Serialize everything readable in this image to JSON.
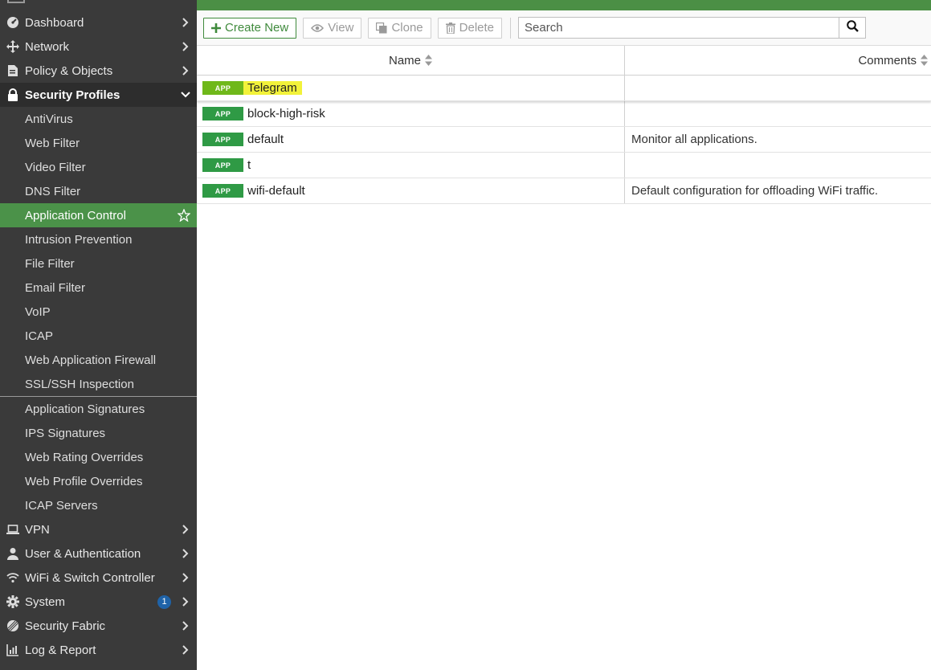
{
  "sidebar": {
    "items": [
      {
        "label": "Dashboard",
        "icon": "dashboard-icon",
        "chevron": "right"
      },
      {
        "label": "Network",
        "icon": "network-icon",
        "chevron": "right"
      },
      {
        "label": "Policy & Objects",
        "icon": "policy-icon",
        "chevron": "right"
      },
      {
        "label": "Security Profiles",
        "icon": "lock-icon",
        "chevron": "down"
      }
    ],
    "security_subitems": [
      "AntiVirus",
      "Web Filter",
      "Video Filter",
      "DNS Filter",
      "Application Control",
      "Intrusion Prevention",
      "File Filter",
      "Email Filter",
      "VoIP",
      "ICAP",
      "Web Application Firewall",
      "SSL/SSH Inspection"
    ],
    "security_subitems2": [
      "Application Signatures",
      "IPS Signatures",
      "Web Rating Overrides",
      "Web Profile Overrides",
      "ICAP Servers"
    ],
    "bottom_items": [
      {
        "label": "VPN",
        "icon": "laptop-icon"
      },
      {
        "label": "User & Authentication",
        "icon": "user-icon"
      },
      {
        "label": "WiFi & Switch Controller",
        "icon": "wifi-icon"
      },
      {
        "label": "System",
        "icon": "gear-icon",
        "badge": "1"
      },
      {
        "label": "Security Fabric",
        "icon": "fabric-icon"
      },
      {
        "label": "Log & Report",
        "icon": "chart-icon"
      }
    ],
    "selected": "Application Control"
  },
  "toolbar": {
    "create_label": "Create New",
    "view_label": "View",
    "clone_label": "Clone",
    "delete_label": "Delete",
    "search_placeholder": "Search"
  },
  "table": {
    "headers": {
      "name": "Name",
      "comments": "Comments"
    },
    "tag_label": "APP",
    "rows": [
      {
        "name": "Telegram",
        "comment": "",
        "highlighted": true
      },
      {
        "name": "block-high-risk",
        "comment": ""
      },
      {
        "name": "default",
        "comment": "Monitor all applications."
      },
      {
        "name": "t",
        "comment": ""
      },
      {
        "name": "wifi-default",
        "comment": "Default configuration for offloading WiFi traffic."
      }
    ]
  },
  "colors": {
    "sidebar_bg": "#3a3a3a",
    "selected_bg": "#4b9249",
    "accent_green": "#3f8a3c",
    "tag_green": "#2f9a45",
    "highlight_yellow": "#f2f23a",
    "badge_blue": "#1f63a8"
  }
}
